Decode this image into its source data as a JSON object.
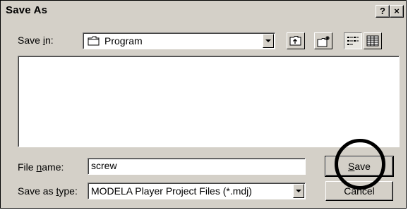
{
  "window": {
    "title": "Save As",
    "help_label": "?",
    "close_label": "×"
  },
  "save_in": {
    "label_pre": "Save ",
    "label_key": "i",
    "label_post": "n:",
    "value": "Program"
  },
  "toolbar": {
    "icons": [
      "up-folder-icon",
      "new-folder-icon",
      "list-view-icon",
      "details-view-icon"
    ]
  },
  "file_name": {
    "label_pre": "File ",
    "label_key": "n",
    "label_post": "ame:",
    "value": "screw"
  },
  "save_type": {
    "label_pre": "Save as ",
    "label_key": "t",
    "label_post": "ype:",
    "value": "MODELA Player Project Files (*.mdj)"
  },
  "buttons": {
    "save_key": "S",
    "save_rest": "ave",
    "cancel": "Cancel"
  }
}
